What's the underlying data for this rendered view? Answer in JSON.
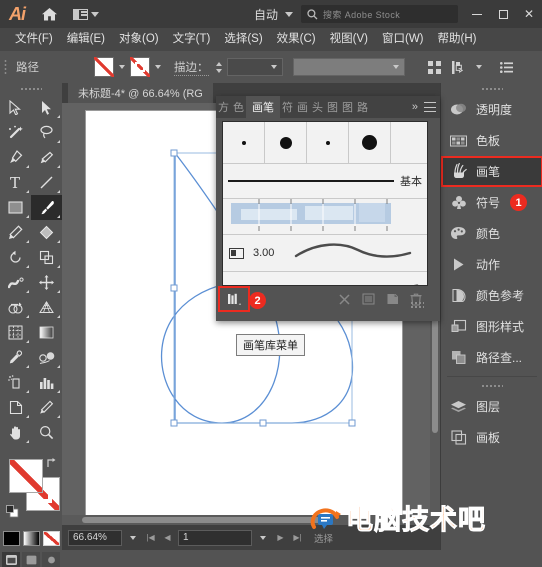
{
  "app": {
    "logo": "Ai",
    "home_icon": "home-icon",
    "arrange_icon": "arrange-documents-icon",
    "auto_label": "自动",
    "search_icon": "search-icon",
    "search_placeholder": "搜索 Adobe Stock",
    "window_buttons": [
      "minimize",
      "maximize",
      "close"
    ]
  },
  "menubar": {
    "items": [
      "文件(F)",
      "编辑(E)",
      "对象(O)",
      "文字(T)",
      "选择(S)",
      "效果(C)",
      "视图(V)",
      "窗口(W)",
      "帮助(H)"
    ]
  },
  "controlbar": {
    "label": "路径",
    "fill_swatch": "none-fill-swatch",
    "stroke_swatch": "none-stroke-swatch",
    "stroke_label": "描边：",
    "stroke_weight": "",
    "profile_value": "",
    "align_icon": "align-icon",
    "transform_icon": "transform-icon",
    "options_icon": "more-options-icon"
  },
  "toolbar": {
    "tools": [
      "selection-tool",
      "direct-selection-tool",
      "magic-wand-tool",
      "lasso-tool",
      "pen-tool",
      "curvature-tool",
      "type-tool",
      "line-segment-tool",
      "rectangle-tool",
      "paintbrush-tool",
      "pencil-tool",
      "shaper-tool",
      "rotate-tool",
      "scale-tool",
      "width-tool",
      "free-transform-tool",
      "shape-builder-tool",
      "perspective-grid-tool",
      "mesh-tool",
      "gradient-tool",
      "eyedropper-tool",
      "blend-tool",
      "symbol-sprayer-tool",
      "column-graph-tool",
      "artboard-tool",
      "slice-tool",
      "hand-tool",
      "zoom-tool"
    ],
    "selected_tool": "paintbrush-tool",
    "fill_label": "fill-swatch",
    "stroke_label": "stroke-swatch",
    "swap_icon": "swap-fill-stroke-icon",
    "default_icon": "default-fill-stroke-icon",
    "color_modes": [
      "color-swatch",
      "gradient-swatch",
      "none-swatch"
    ],
    "screen_modes": [
      "normal-screen-mode",
      "full-screen-with-menu",
      "full-screen-mode"
    ]
  },
  "document": {
    "tab_title": "未标题-4* @ 66.64% (RG"
  },
  "statusbar": {
    "zoom": "66.64%",
    "page": "1",
    "status_text": "选择",
    "nav_first": "first-page",
    "nav_prev": "previous-page",
    "nav_next": "next-page",
    "nav_last": "last-page"
  },
  "dock": {
    "groups": [
      {
        "items": [
          {
            "label": "透明度",
            "icon": "transparency-icon",
            "highlight": false,
            "badge": null
          },
          {
            "label": "色板",
            "icon": "swatches-icon",
            "highlight": false,
            "badge": null
          },
          {
            "label": "画笔",
            "icon": "brushes-icon",
            "highlight": true,
            "badge": "1"
          },
          {
            "label": "符号",
            "icon": "symbols-icon",
            "highlight": false,
            "badge": null
          },
          {
            "label": "颜色",
            "icon": "color-icon",
            "highlight": false,
            "badge": null
          },
          {
            "label": "动作",
            "icon": "actions-icon",
            "highlight": false,
            "badge": null
          },
          {
            "label": "颜色参考",
            "icon": "color-guide-icon",
            "highlight": false,
            "badge": null
          },
          {
            "label": "图形样式",
            "icon": "graphic-styles-icon",
            "highlight": false,
            "badge": null
          },
          {
            "label": "路径查...",
            "icon": "pathfinder-icon",
            "highlight": false,
            "badge": null
          }
        ]
      },
      {
        "items": [
          {
            "label": "图层",
            "icon": "layers-icon",
            "highlight": false,
            "badge": null
          },
          {
            "label": "画板",
            "icon": "artboards-icon",
            "highlight": false,
            "badge": null
          }
        ]
      }
    ]
  },
  "brushes_panel": {
    "tabs": [
      {
        "label": "方",
        "active": false,
        "clipped": true
      },
      {
        "label": "色",
        "active": false,
        "clipped": true
      },
      {
        "label": "画笔",
        "active": true,
        "clipped": false
      },
      {
        "label": "符",
        "active": false,
        "clipped": true
      },
      {
        "label": "画",
        "active": false,
        "clipped": true
      },
      {
        "label": "头",
        "active": false,
        "clipped": true
      },
      {
        "label": "图",
        "active": false,
        "clipped": true
      },
      {
        "label": "图",
        "active": false,
        "clipped": true
      },
      {
        "label": "路",
        "active": false,
        "clipped": true
      }
    ],
    "overflow_label": "»",
    "menu_icon": "panel-menu-icon",
    "calligraphic_brushes": [
      {
        "name": "1-pt-round",
        "size": 3
      },
      {
        "name": "5-pt-round",
        "size": 11
      },
      {
        "name": "3-pt-round",
        "size": 4
      },
      {
        "name": "10-pt-round",
        "size": 14
      }
    ],
    "basic_brush": {
      "name": "基本"
    },
    "pattern_brush": {
      "name": "pattern-brush-thumbnail"
    },
    "art_brush": {
      "value": "3.00",
      "icon": "art-brush-icon",
      "stroke": "tapered-stroke-thumbnail"
    },
    "bristle_brush": {
      "name": "charcoal-brush-thumbnail"
    },
    "footer": {
      "library_button": "画笔库菜单",
      "library_icon": "brush-libraries-menu-icon",
      "libraries_panel_icon": "libraries-panel-icon",
      "remove_link_icon": "remove-brush-stroke-icon",
      "options_icon": "brush-options-icon",
      "new_brush_icon": "new-brush-icon",
      "delete_icon": "delete-brush-icon",
      "badge": "2"
    }
  },
  "tooltip": {
    "text": "画笔库菜单"
  },
  "watermark": {
    "text": "电脑技术吧",
    "icon": "watermark-logo-icon"
  },
  "colors": {
    "accent_red": "#ec2b20",
    "panel_bg": "#535353",
    "titlebar_bg": "#3b3b3b",
    "path_blue": "#5b8fd4",
    "watermark_orange": "#f2731d"
  }
}
